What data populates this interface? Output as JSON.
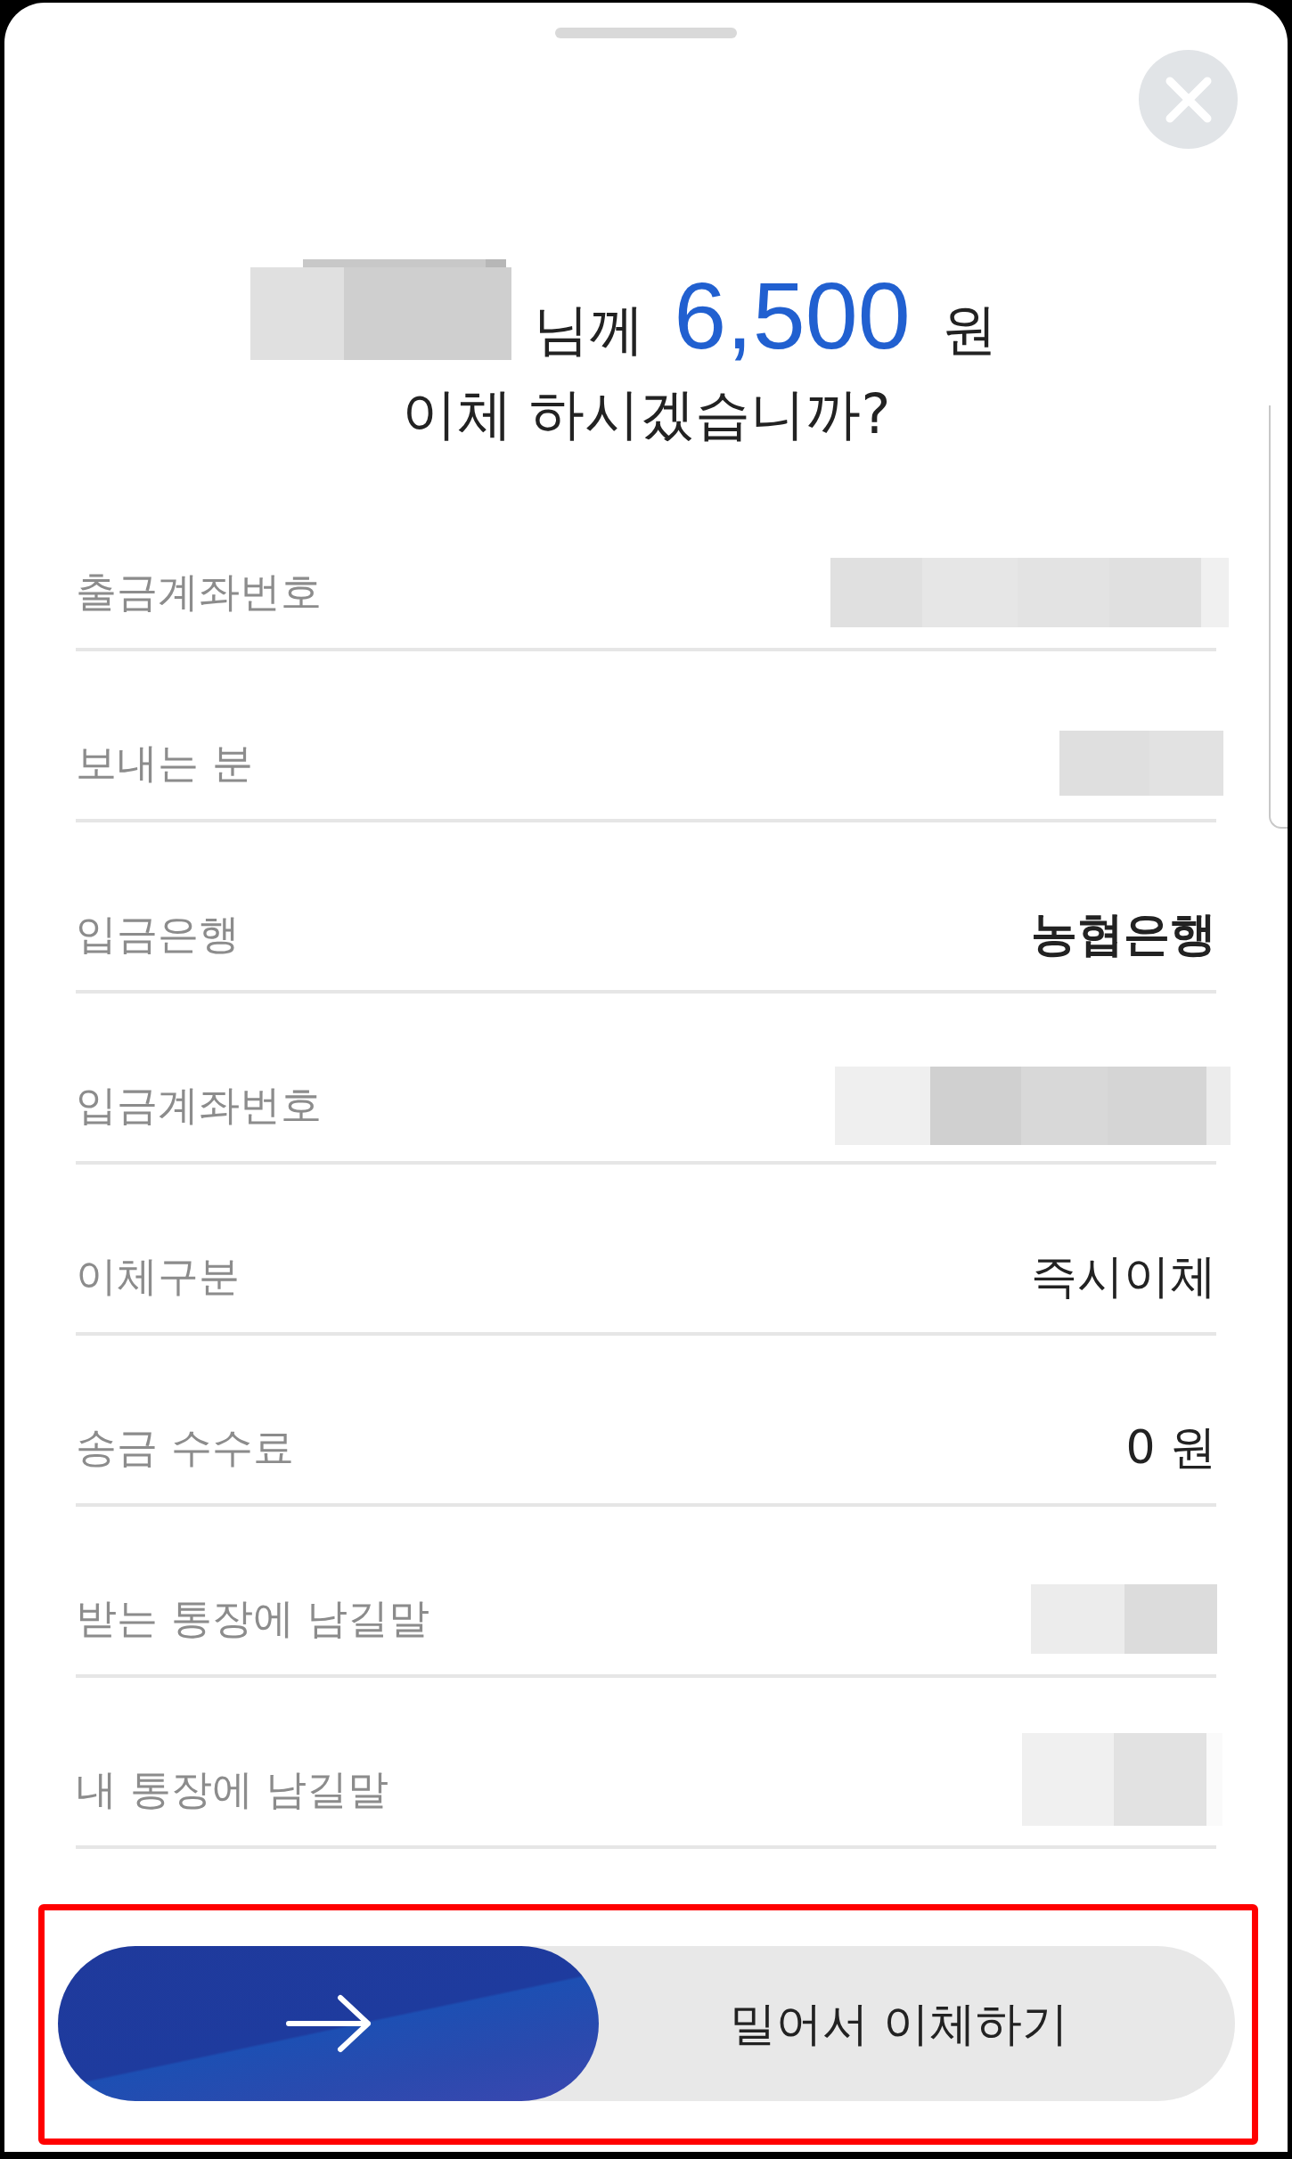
{
  "title": {
    "recipient_suffix": "님께",
    "amount": "6,500",
    "currency": "원",
    "question": "이체 하시겠습니까?"
  },
  "details": [
    {
      "kind": "redacted",
      "label": "출금계좌번호"
    },
    {
      "kind": "redacted",
      "label": "보내는 분"
    },
    {
      "kind": "strong",
      "label": "입금은행",
      "value": "농협은행"
    },
    {
      "kind": "redacted",
      "label": "입금계좌번호"
    },
    {
      "kind": "plain",
      "label": "이체구분",
      "value": "즉시이체"
    },
    {
      "kind": "plain",
      "label": "송금 수수료",
      "value": "0 원"
    },
    {
      "kind": "redacted",
      "label": "받는 통장에 남길말"
    },
    {
      "kind": "redacted",
      "label": "내 통장에 남길말"
    }
  ],
  "slide_button": {
    "label": "밀어서 이체하기"
  }
}
